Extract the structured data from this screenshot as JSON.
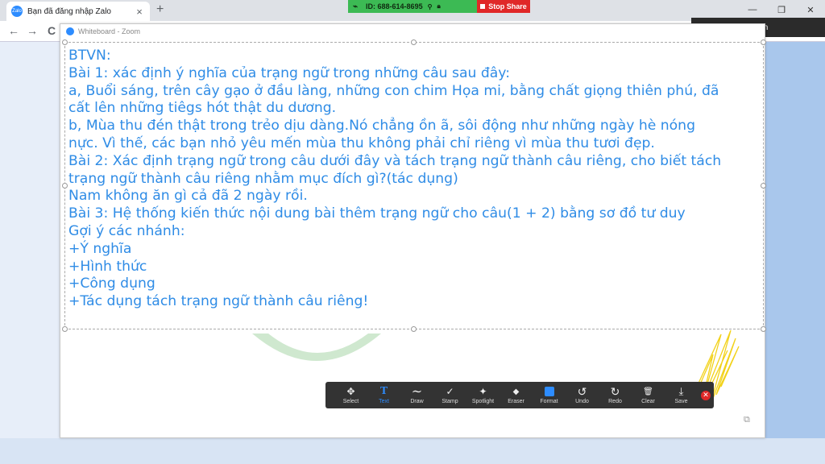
{
  "browser": {
    "tab_title": "Bạn đã đăng nhập Zalo",
    "tab_favicon": "Zalo",
    "tab_close": "×",
    "new_tab": "+",
    "back": "←",
    "forward": "→",
    "reload": "C",
    "window_controls": [
      "—",
      "❐",
      "✕"
    ]
  },
  "share_bar": {
    "meeting_id": "ID: 688-614-8695",
    "stop_label": "Stop Share"
  },
  "talking": "Talking: Đặng Liên",
  "whiteboard": {
    "title": "Whiteboard - Zoom",
    "text_lines": [
      "BTVN:",
      "Bài 1: xác định ý nghĩa của trạng ngữ trong những câu sau đây:",
      "a, Buổi sáng, trên cây gạo ở đầu làng, những con chim Họa mi, bằng chất giọng thiên phú, đã",
      "cất lên những tiêgs hót thật du dương.",
      "b, Mùa thu đén thật trong trẻo dịu dàng.Nó chẳng ồn ã, sôi động như những ngày hè nóng",
      "nực. Vì thế, các bạn nhỏ yêu mến mùa thu không phải chỉ riêng vì mùa thu tươi đẹp.",
      "Bài 2: Xác định trạng ngữ trong câu dưới đây và tách trạng ngữ thành câu riêng, cho biết tách",
      "trạng ngữ thành câu riêng nhằm mục đích gì?(tác dụng)",
      "Nam không ăn gì cả đã 2 ngày rồi.",
      "Bài 3: Hệ thống kiến thức nội dung bài thêm trạng ngữ cho câu(1 + 2) bằng sơ đồ tư duy",
      "Gợi ý các nhánh:",
      "+Ý nghĩa",
      "+Hình thức",
      "+Công dụng",
      "+Tác dụng tách trạng ngữ thành câu riêng!"
    ],
    "text_color": "#2f8ce6"
  },
  "annotation_toolbar": {
    "tools": [
      {
        "label": "Select",
        "icon": "✥",
        "icon_name": "move-icon",
        "active": false
      },
      {
        "label": "Text",
        "icon": "T",
        "icon_name": "text-icon",
        "active": true
      },
      {
        "label": "Draw",
        "icon": "∼",
        "icon_name": "draw-icon",
        "active": false
      },
      {
        "label": "Stamp",
        "icon": "✓",
        "icon_name": "stamp-icon",
        "active": false
      },
      {
        "label": "Spotlight",
        "icon": "✦",
        "icon_name": "spotlight-icon",
        "active": false
      },
      {
        "label": "Eraser",
        "icon": "◆",
        "icon_name": "eraser-icon",
        "active": false
      },
      {
        "label": "Format",
        "icon": "",
        "icon_name": "format-icon",
        "active": false
      },
      {
        "label": "Undo",
        "icon": "↺",
        "icon_name": "undo-icon",
        "active": false
      },
      {
        "label": "Redo",
        "icon": "↻",
        "icon_name": "redo-icon",
        "active": false
      },
      {
        "label": "Clear",
        "icon": "🗑",
        "icon_name": "trash-icon",
        "active": false
      },
      {
        "label": "Save",
        "icon": "⤓",
        "icon_name": "save-icon",
        "active": false
      }
    ],
    "close": "✕"
  },
  "colors": {
    "accent": "#2d8cff",
    "share_green": "#3cba54",
    "stop_red": "#e02828"
  }
}
